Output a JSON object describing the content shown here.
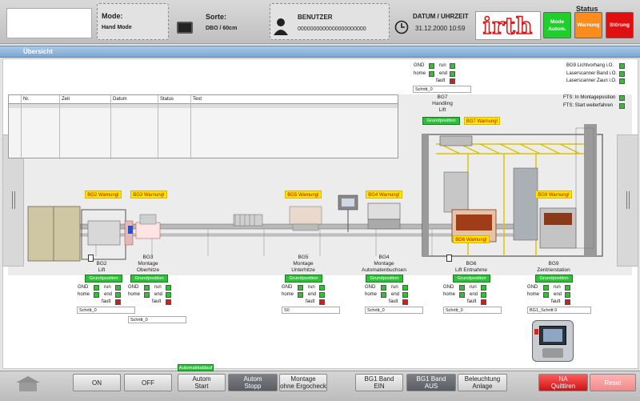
{
  "header": {
    "mode_label": "Mode:",
    "mode_value": "Hand Mode",
    "sorte_label": "Sorte:",
    "sorte_value": "DBO / 60cm",
    "user_label": "BENUTZER",
    "user_value": "0000000000000000000000",
    "datetime_label": "DATUM / UHRZEIT",
    "datetime_value": "31.12.2000 10:59",
    "logo_text": "irth",
    "status_title": "Status",
    "status_buttons": [
      {
        "label": "Mode Autom.",
        "color": "#1fcf2a"
      },
      {
        "label": "Warnung",
        "color": "#ff8c1a"
      },
      {
        "label": "Störung",
        "color": "#e01010"
      }
    ]
  },
  "tab": {
    "title": "Übersicht"
  },
  "log_table": {
    "columns": [
      "Nr.",
      "Zeit",
      "Datum",
      "Status",
      "Text"
    ]
  },
  "top_status": {
    "items": [
      "BG9 Lichtvorhang i.O.",
      "Laserscanner Band i.O.",
      "Laserscanner Zaun i.O."
    ],
    "fts": [
      "FTS: In Montageposition",
      "FTS: Start weiterfahren"
    ]
  },
  "io_labels": {
    "gnd": "GND",
    "home": "home",
    "run": "run",
    "end": "end",
    "fault": "fault"
  },
  "stations": {
    "bg7": {
      "name": "BG7\nHandling\nLift",
      "grund": "Grundposition",
      "warn": "BG7 Warnung!",
      "field": "Schritt_0"
    },
    "bg2": {
      "name": "BG2\nLift",
      "grund": "Grundposition",
      "warn": "BG2 Warnung!",
      "field": "Schritt_0"
    },
    "bg3": {
      "name": "BG3\nMontage\nOberhitze",
      "grund": "Grundposition",
      "warn": "BG3 Warnung!",
      "field": "Schritt_0"
    },
    "bg5": {
      "name": "BG5\nMontage\nUnterhitze",
      "grund": "Grundposition",
      "warn": "BG5 Warnung!",
      "field": "S0"
    },
    "bg4": {
      "name": "BG4\nMontage\nAutomatenbuchsen",
      "grund": "Grundposition",
      "warn": "BG4 Warnung!",
      "field": "Schritt_0"
    },
    "bg6": {
      "name": "BG6\nLift Entnahme",
      "grund": "Grundposition",
      "warn": "BG6 Warnung!",
      "field": "Schritt_0"
    },
    "bg9": {
      "name": "BG9\nZentrierstation",
      "grund": "Grundposition",
      "warn": "BG9 Warnung!",
      "field": "BG1_Schritt 0"
    }
  },
  "bottom": {
    "automatik_label": "Automatikablauf",
    "buttons": [
      "ON",
      "OFF",
      "Autom\nStart",
      "Autom\nStopp",
      "Montage\nohne Ergocheck",
      "BG1 Band\nEIN",
      "BG1 Band\nAUS",
      "Beleuchtung\nAnlage",
      "NA\nQuittiren",
      "Reset"
    ]
  }
}
